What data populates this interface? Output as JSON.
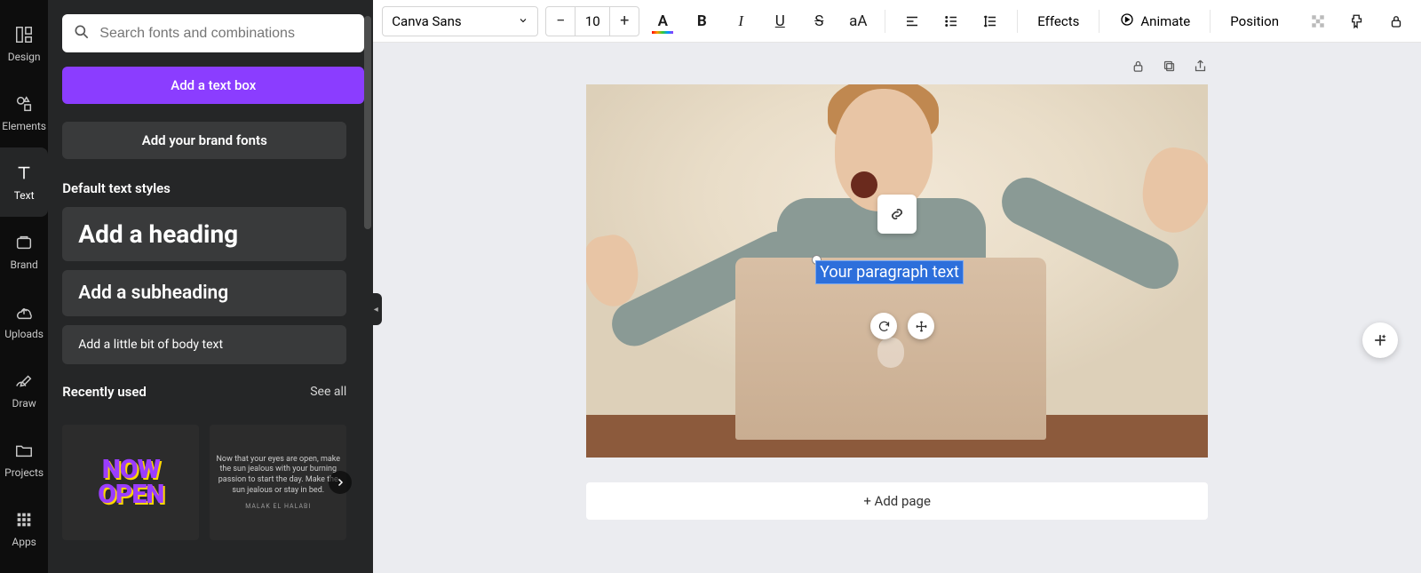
{
  "rail": [
    {
      "label": "Design",
      "icon": "design"
    },
    {
      "label": "Elements",
      "icon": "elements"
    },
    {
      "label": "Text",
      "icon": "text",
      "active": true
    },
    {
      "label": "Brand",
      "icon": "brand"
    },
    {
      "label": "Uploads",
      "icon": "uploads"
    },
    {
      "label": "Draw",
      "icon": "draw"
    },
    {
      "label": "Projects",
      "icon": "projects"
    },
    {
      "label": "Apps",
      "icon": "apps"
    }
  ],
  "panel": {
    "search_placeholder": "Search fonts and combinations",
    "add_text_box": "Add a text box",
    "add_brand_fonts": "Add your brand fonts",
    "default_styles_title": "Default text styles",
    "styles": {
      "heading": "Add a heading",
      "subheading": "Add a subheading",
      "body": "Add a little bit of body text"
    },
    "recently_used": "Recently used",
    "see_all": "See all",
    "recent": [
      {
        "line1": "NOW",
        "line2": "OPEN"
      },
      {
        "quote": "Now that your eyes are open, make the sun jealous with your burning passion to start the day. Make the sun jealous or stay in bed.",
        "author": "MALAK EL HALABI"
      }
    ]
  },
  "toolbar": {
    "font": "Canva Sans",
    "size": "10",
    "effects": "Effects",
    "animate": "Animate",
    "position": "Position"
  },
  "canvas": {
    "text_value": "Your paragraph text",
    "add_page": "+ Add page"
  }
}
